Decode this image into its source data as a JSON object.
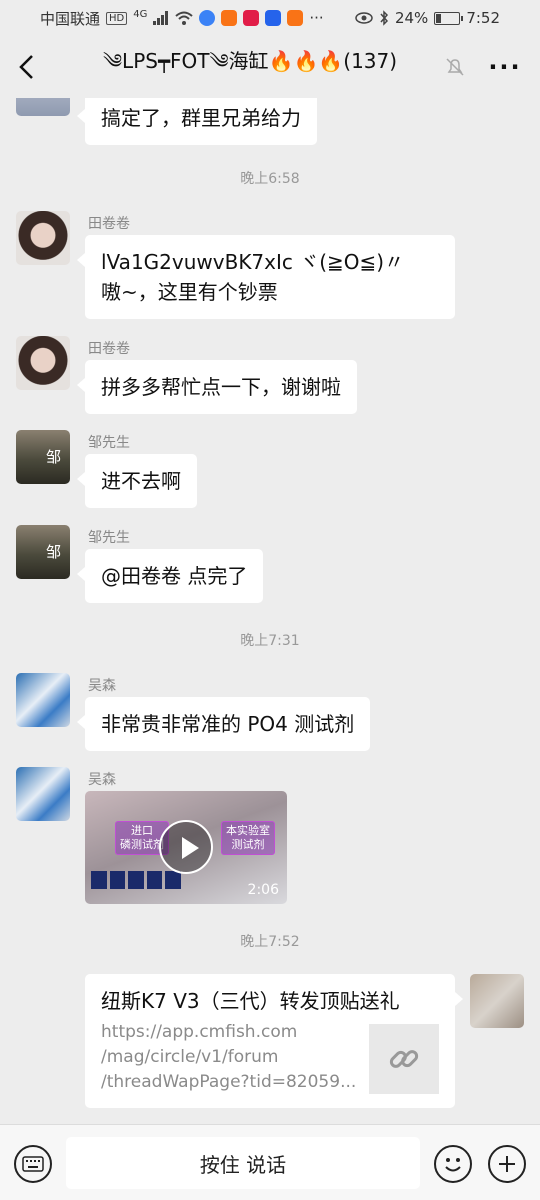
{
  "status_bar": {
    "carrier": "中国联通",
    "network": "4G",
    "battery_percent": "24%",
    "battery_level": 0.24,
    "time": "7:52"
  },
  "header": {
    "title": "༄LPS┯FOT༄海缸🔥🔥🔥(137)",
    "icons": [
      "back-arrow-icon",
      "mute-bell-icon",
      "more-icon"
    ]
  },
  "messages": [
    {
      "type": "text",
      "side": "left",
      "nick": "",
      "text": "搞定了，群里兄弟给力"
    },
    {
      "type": "time",
      "text": "晚上6:58"
    },
    {
      "type": "text",
      "side": "left",
      "nick": "田卷卷",
      "lines": [
        "lVa1G2vuwvBK7xIc ヾ(≧O≦)〃",
        "嗷~，这里有个钞票"
      ]
    },
    {
      "type": "text",
      "side": "left",
      "nick": "田卷卷",
      "text": "拼多多帮忙点一下，谢谢啦"
    },
    {
      "type": "text",
      "side": "left",
      "nick": "邹先生",
      "avatar_char": "邹",
      "text": "进不去啊"
    },
    {
      "type": "text",
      "side": "left",
      "nick": "邹先生",
      "avatar_char": "邹",
      "text": "@田卷卷  点完了"
    },
    {
      "type": "time",
      "text": "晚上7:31"
    },
    {
      "type": "text",
      "side": "left",
      "nick": "吴森",
      "text": "非常贵非常准的 PO4 测试剂"
    },
    {
      "type": "video",
      "side": "left",
      "nick": "吴森",
      "duration": "2:06",
      "tag_left": [
        "进口",
        "磷测试剂"
      ],
      "tag_right": [
        "本实验室",
        "测试剂"
      ]
    },
    {
      "type": "time",
      "text": "晚上7:52"
    },
    {
      "type": "link",
      "side": "right",
      "title": "纽斯K7 V3（三代）转发顶贴送礼",
      "url_lines": [
        "https://app.cmfish.com",
        "/mag/circle/v1/forum",
        "/threadWapPage?tid=82059..."
      ]
    }
  ],
  "input_bar": {
    "hold_to_talk": "按住 说话"
  }
}
